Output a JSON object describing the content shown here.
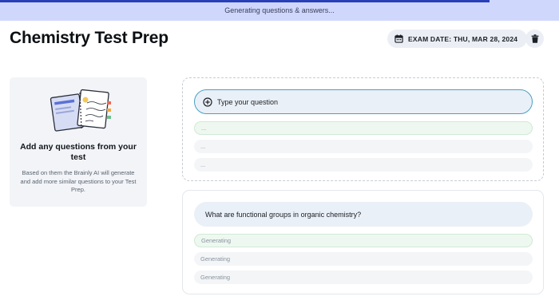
{
  "banner": {
    "text": "Generating questions & answers...",
    "progress_fraction": 0.875,
    "colors": {
      "background": "#cfd7fd",
      "fill": "#2a40b8"
    }
  },
  "header": {
    "title": "Chemistry Test Prep",
    "exam_date_label": "EXAM DATE: THU, MAR 28, 2024",
    "calendar_icon": "calendar-icon",
    "delete_icon": "trash-icon"
  },
  "info_card": {
    "title": "Add any questions from your test",
    "description": "Based on them the Brainly AI will generate and add more similar questions to your Test Prep."
  },
  "add_question": {
    "icon": "plus-circle-icon",
    "placeholder": "Type your question",
    "answers": [
      "...",
      "...",
      "..."
    ]
  },
  "generated": {
    "question": "What are functional groups in organic chemistry?",
    "answers": [
      "Generating",
      "Generating",
      "Generating"
    ]
  }
}
